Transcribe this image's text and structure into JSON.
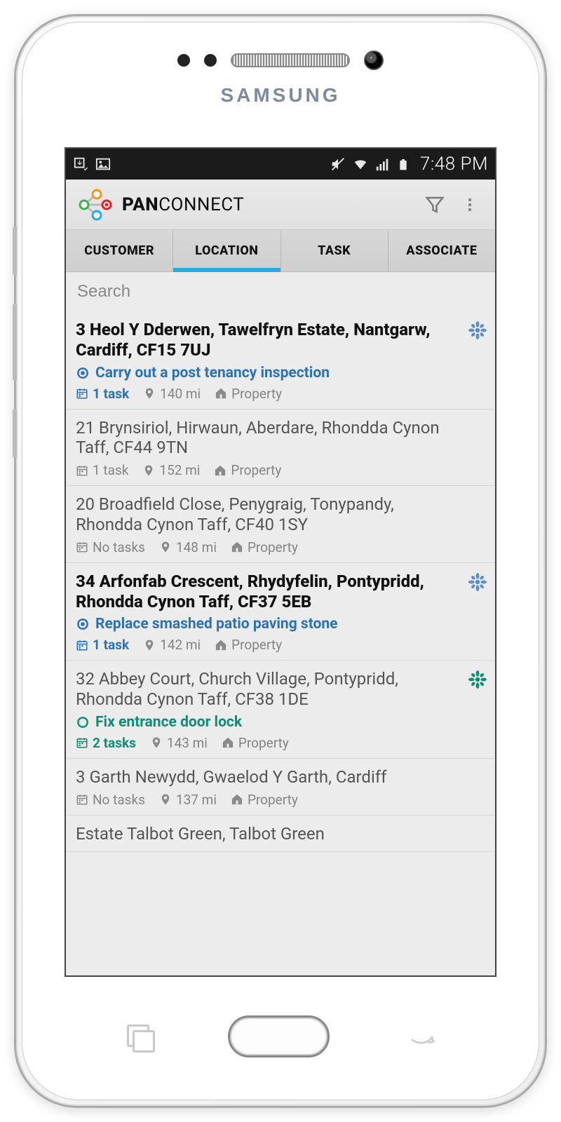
{
  "status_bar": {
    "time": "7:48 PM"
  },
  "header": {
    "brand_bold": "PAN",
    "brand_light": "CONNECT"
  },
  "tabs": [
    {
      "label": "CUSTOMER",
      "active": false
    },
    {
      "label": "LOCATION",
      "active": true
    },
    {
      "label": "TASK",
      "active": false
    },
    {
      "label": "ASSOCIATE",
      "active": false
    }
  ],
  "search": {
    "placeholder": "Search"
  },
  "type_label": "Property",
  "items": [
    {
      "address": "3 Heol Y Dderwen, Tawelfryn Estate, Nantgarw, Cardiff, CF15 7UJ",
      "highlight": true,
      "action": "Carry out a post tenancy inspection",
      "action_color": "blue",
      "tasks": "1 task",
      "task_color": "blue",
      "distance": "140 mi",
      "star": "blue"
    },
    {
      "address": "21 Brynsiriol, Hirwaun, Aberdare, Rhondda Cynon Taff, CF44 9TN",
      "highlight": false,
      "tasks": "1 task",
      "distance": "152 mi"
    },
    {
      "address": "20 Broadfield Close, Penygraig, Tonypandy, Rhondda Cynon Taff, CF40 1SY",
      "highlight": false,
      "tasks": "No tasks",
      "distance": "148 mi"
    },
    {
      "address": "34 Arfonfab Crescent, Rhydyfelin, Pontypridd, Rhondda Cynon Taff, CF37 5EB",
      "highlight": true,
      "action": "Replace smashed patio paving stone",
      "action_color": "blue",
      "tasks": "1 task",
      "task_color": "blue",
      "distance": "142 mi",
      "star": "blue"
    },
    {
      "address": "32 Abbey Court, Church Village, Pontypridd, Rhondda Cynon Taff, CF38 1DE",
      "highlight": false,
      "action": "Fix entrance door lock",
      "action_color": "teal",
      "tasks": "2 tasks",
      "task_color": "teal",
      "distance": "143 mi",
      "star": "teal"
    },
    {
      "address": "3 Garth Newydd, Gwaelod Y Garth, Cardiff",
      "highlight": false,
      "tasks": "No tasks",
      "distance": "137 mi"
    },
    {
      "address": "Estate Talbot Green, Talbot Green",
      "highlight": false
    }
  ],
  "colors": {
    "blue": "#5a8fcf",
    "teal": "#0c8f75",
    "icon_gray": "#8a8a8a"
  },
  "device": {
    "brand": "SAMSUNG"
  }
}
